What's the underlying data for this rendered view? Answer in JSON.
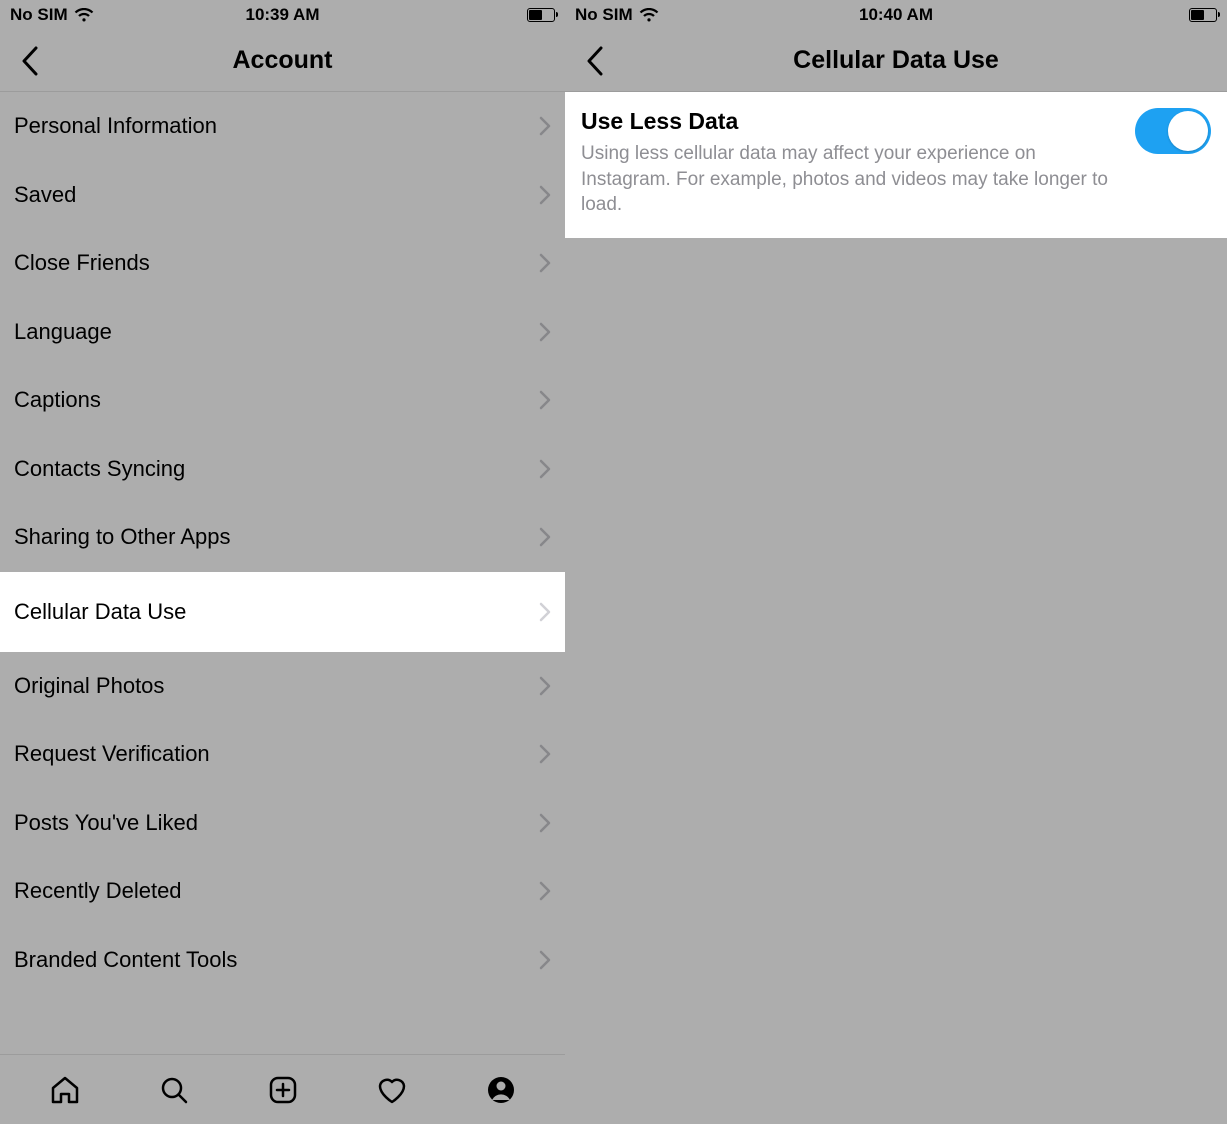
{
  "left": {
    "status": {
      "carrier": "No SIM",
      "time": "10:39 AM"
    },
    "nav": {
      "title": "Account"
    },
    "items": [
      {
        "label": "Personal Information"
      },
      {
        "label": "Saved"
      },
      {
        "label": "Close Friends"
      },
      {
        "label": "Language"
      },
      {
        "label": "Captions"
      },
      {
        "label": "Contacts Syncing"
      },
      {
        "label": "Sharing to Other Apps"
      },
      {
        "label": "Cellular Data Use",
        "highlight": true
      },
      {
        "label": "Original Photos"
      },
      {
        "label": "Request Verification"
      },
      {
        "label": "Posts You've Liked"
      },
      {
        "label": "Recently Deleted"
      },
      {
        "label": "Branded Content Tools"
      }
    ]
  },
  "right": {
    "status": {
      "carrier": "No SIM",
      "time": "10:40 AM"
    },
    "nav": {
      "title": "Cellular Data Use"
    },
    "setting": {
      "title": "Use Less Data",
      "description": "Using less cellular data may affect your experience on Instagram. For example, photos and videos may take longer to load.",
      "enabled": true
    }
  }
}
